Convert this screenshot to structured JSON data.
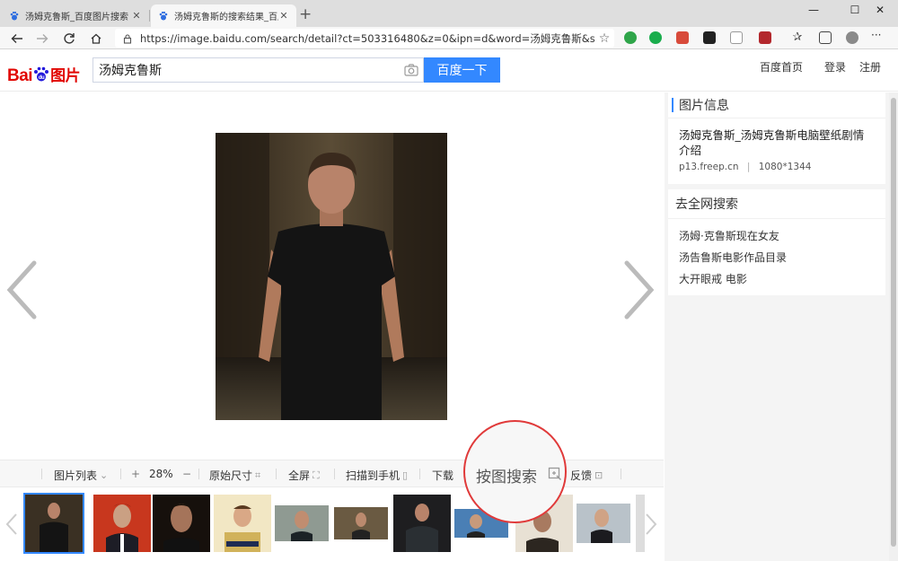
{
  "browser": {
    "tabs": [
      {
        "title": "汤姆克鲁斯_百度图片搜索",
        "close": "✕"
      },
      {
        "title": "汤姆克鲁斯的搜索结果_百度图片",
        "close": "✕"
      }
    ],
    "new_tab": "+",
    "window_controls": {
      "minimize": "—",
      "maximize": "☐",
      "close": "✕"
    },
    "url": "https://image.baidu.com/search/detail?ct=503316480&z=0&ipn=d&word=汤姆克鲁斯&step_word=...",
    "more_menu": "···"
  },
  "header": {
    "logo_bai": "Bai",
    "logo_du": "du",
    "logo_tupian": "图片",
    "search_value": "汤姆克鲁斯",
    "search_button": "百度一下",
    "links": [
      "百度首页",
      "登录",
      "注册"
    ]
  },
  "sidebar": {
    "info_title": "图片信息",
    "info_description": "汤姆克鲁斯_汤姆克鲁斯电脑壁纸剧情介绍",
    "info_source": "p13.freep.cn",
    "info_sep": "|",
    "info_size": "1080*1344",
    "web_search_title": "去全网搜索",
    "related": [
      "汤姆·克鲁斯现在女友",
      "汤告鲁斯电影作品目录",
      "大开眼戒 电影"
    ]
  },
  "toolbar": {
    "image_list": "图片列表",
    "zoom_in": "+",
    "zoom": "28%",
    "zoom_out": "−",
    "original_size": "原始尺寸",
    "fullscreen": "全屏",
    "scan_to_phone": "扫描到手机",
    "download": "下载",
    "search_by_image": "按图搜索",
    "feedback": "反馈"
  },
  "colors": {
    "accent": "#3388ff",
    "highlight_circle": "#e03a3a",
    "baidu_red": "#e10602",
    "baidu_blue": "#2319dc"
  }
}
